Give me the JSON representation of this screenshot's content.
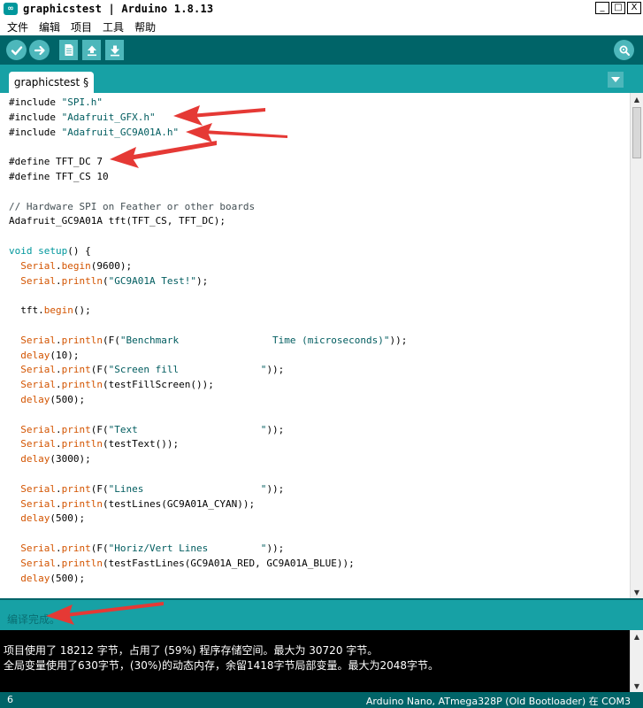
{
  "window": {
    "title": "graphicstest | Arduino 1.8.13",
    "logo_text": "∞",
    "controls": {
      "minimize": "_",
      "maximize": "□",
      "close": "X"
    }
  },
  "menu": {
    "items": [
      "文件",
      "编辑",
      "项目",
      "工具",
      "帮助"
    ]
  },
  "toolbar": {
    "buttons": [
      "verify-icon",
      "upload-icon",
      "new-icon",
      "open-icon",
      "save-icon"
    ],
    "serial_monitor": "serial-monitor-icon"
  },
  "tabs": [
    {
      "label": "graphicstest §"
    }
  ],
  "code": {
    "lines": [
      "#include \"SPI.h\"",
      "#include \"Adafruit_GFX.h\"",
      "#include \"Adafruit_GC9A01A.h\"",
      "",
      "#define TFT_DC 7",
      "#define TFT_CS 10",
      "",
      "// Hardware SPI on Feather or other boards",
      "Adafruit_GC9A01A tft(TFT_CS, TFT_DC);",
      "",
      "void setup() {",
      "  Serial.begin(9600);",
      "  Serial.println(\"GC9A01A Test!\");",
      "",
      "  tft.begin();",
      "",
      "  Serial.println(F(\"Benchmark                Time (microseconds)\"));",
      "  delay(10);",
      "  Serial.print(F(\"Screen fill              \"));",
      "  Serial.println(testFillScreen());",
      "  delay(500);",
      "",
      "  Serial.print(F(\"Text                     \"));",
      "  Serial.println(testText());",
      "  delay(3000);",
      "",
      "  Serial.print(F(\"Lines                    \"));",
      "  Serial.println(testLines(GC9A01A_CYAN));",
      "  delay(500);",
      "",
      "  Serial.print(F(\"Horiz/Vert Lines         \"));",
      "  Serial.println(testFastLines(GC9A01A_RED, GC9A01A_BLUE));",
      "  delay(500);"
    ]
  },
  "status": {
    "message": "编译完成。"
  },
  "console": {
    "lines": [
      "项目使用了 18212 字节，占用了 (59%) 程序存储空间。最大为 30720 字节。",
      "全局变量使用了630字节，(30%)的动态内存，余留1418字节局部变量。最大为2048字节。"
    ]
  },
  "footer": {
    "line_number": "6",
    "board": "Arduino Nano, ATmega328P (Old Bootloader) 在 COM3"
  },
  "colors": {
    "toolbar": "#006468",
    "tabbar": "#17a1a5",
    "button": "#4db7bb",
    "keyword": "#00979c",
    "function": "#d35400",
    "annotation_arrow": "#e53935"
  }
}
